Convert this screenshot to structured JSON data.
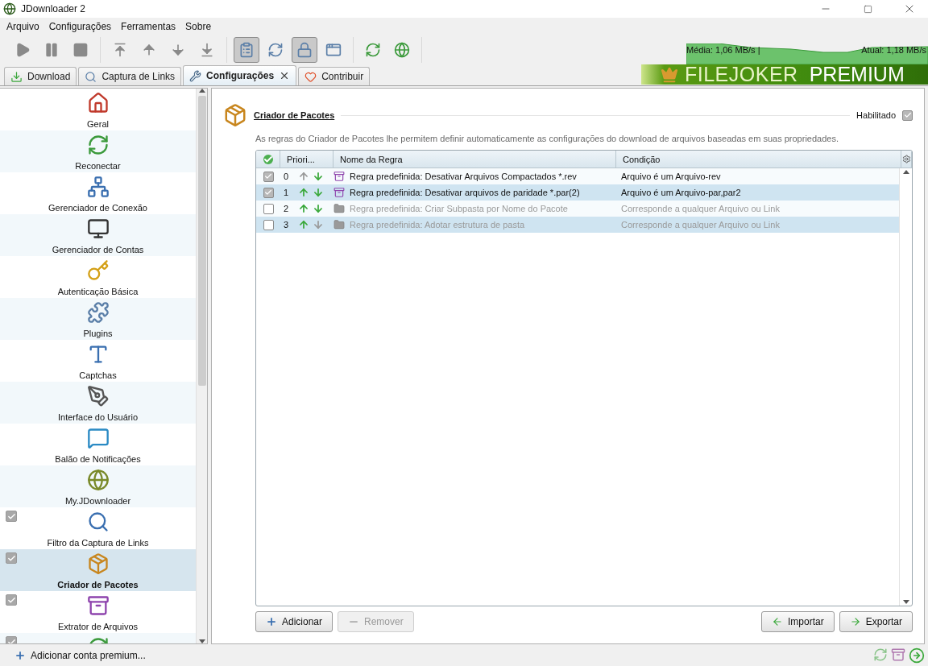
{
  "window": {
    "title": "JDownloader 2"
  },
  "menu": [
    "Arquivo",
    "Configurações",
    "Ferramentas",
    "Sobre"
  ],
  "toolbar": [
    [
      {
        "pressed": false
      },
      {
        "pressed": false
      },
      {
        "pressed": false
      }
    ],
    [
      {
        "pressed": false
      },
      {
        "pressed": false
      },
      {
        "pressed": false
      },
      {
        "pressed": false
      }
    ],
    [
      {
        "pressed": true
      },
      {
        "pressed": false
      },
      {
        "pressed": true
      },
      {
        "pressed": false
      }
    ],
    [
      {
        "pressed": false
      },
      {
        "pressed": false
      }
    ]
  ],
  "speed": {
    "average": "Média: 1,06 MB/s |",
    "current": "Atual: 1,18 MB/s"
  },
  "tabs": [
    {
      "label": "Download",
      "selected": false,
      "closable": false
    },
    {
      "label": "Captura de Links",
      "selected": false,
      "closable": false
    },
    {
      "label": "Configurações",
      "selected": true,
      "closable": true
    },
    {
      "label": "Contribuir",
      "selected": false,
      "closable": false
    }
  ],
  "banner": {
    "brand": "FILEJOKER",
    "tier": "PREMIUM"
  },
  "sidebar": {
    "items": [
      {
        "label": "Geral",
        "selected": false,
        "checkable": false
      },
      {
        "label": "Reconectar",
        "selected": false,
        "checkable": false
      },
      {
        "label": "Gerenciador de Conexão",
        "selected": false,
        "checkable": false
      },
      {
        "label": "Gerenciador de Contas",
        "selected": false,
        "checkable": false
      },
      {
        "label": "Autenticação Básica",
        "selected": false,
        "checkable": false
      },
      {
        "label": "Plugins",
        "selected": false,
        "checkable": false
      },
      {
        "label": "Captchas",
        "selected": false,
        "checkable": false
      },
      {
        "label": "Interface do Usuário",
        "selected": false,
        "checkable": false
      },
      {
        "label": "Balão de Notificações",
        "selected": false,
        "checkable": false
      },
      {
        "label": "My.JDownloader",
        "selected": false,
        "checkable": false
      },
      {
        "label": "Filtro da Captura de Links",
        "selected": false,
        "checkable": true,
        "checked": true
      },
      {
        "label": "Criador de Pacotes",
        "selected": true,
        "checkable": true,
        "checked": true
      },
      {
        "label": "Extrator de Arquivos",
        "selected": false,
        "checkable": true,
        "checked": true
      },
      {
        "selected": false,
        "checkable": true,
        "checked": true
      }
    ]
  },
  "panel": {
    "title": "Criador de Pacotes",
    "enabled_label": "Habilitado",
    "enabled": true,
    "description": "As regras do Criador de Pacotes lhe permitem definir automaticamente as configurações do download de arquivos baseadas em suas propriedades.",
    "table": {
      "columns": [
        "Priori...",
        "Nome da Regra",
        "Condição"
      ],
      "rows": [
        {
          "enabled": true,
          "priority": "0",
          "can_up": false,
          "can_down": true,
          "kind": "archive",
          "name": "Regra predefinida: Desativar Arquivos Compactados *.rev",
          "condition": "Arquivo é um Arquivo-rev"
        },
        {
          "enabled": true,
          "priority": "1",
          "can_up": true,
          "can_down": true,
          "kind": "archive",
          "name": "Regra predefinida: Desativar arquivos de paridade *.par(2)",
          "condition": "Arquivo é um Arquivo-par,par2"
        },
        {
          "enabled": false,
          "priority": "2",
          "can_up": true,
          "can_down": true,
          "kind": "folder",
          "name": "Regra predefinida: Criar Subpasta por Nome do Pacote",
          "condition": "Corresponde a qualquer Arquivo ou Link"
        },
        {
          "enabled": false,
          "priority": "3",
          "can_up": true,
          "can_down": false,
          "kind": "folder",
          "name": "Regra predefinida: Adotar estrutura de pasta",
          "condition": "Corresponde a qualquer Arquivo ou Link"
        }
      ]
    },
    "buttons_left": [
      {
        "label": "Adicionar",
        "disabled": false
      },
      {
        "label": "Remover",
        "disabled": true
      }
    ],
    "buttons_right": [
      {
        "label": "Importar",
        "disabled": false
      },
      {
        "label": "Exportar",
        "disabled": false
      }
    ]
  },
  "status_bar": {
    "link": "Adicionar conta premium..."
  }
}
